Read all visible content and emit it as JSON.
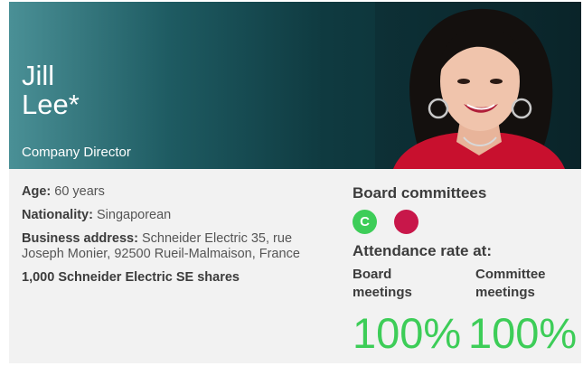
{
  "profile": {
    "name_line1": "Jill",
    "name_line2": "Lee*",
    "role": "Company Director"
  },
  "details": {
    "age_label": "Age:",
    "age_value": "60 years",
    "nationality_label": "Nationality:",
    "nationality_value": "Singaporean",
    "address_label": "Business address:",
    "address_value": "Schneider Electric 35, rue Joseph Monier, 92500 Rueil-Malmaison, France",
    "shares": "1,000 Schneider Electric SE shares"
  },
  "committees": {
    "heading": "Board committees",
    "badges": [
      {
        "letter": "C",
        "color": "#3dcd58"
      },
      {
        "letter": "",
        "color": "#c8174a"
      }
    ]
  },
  "attendance": {
    "heading": "Attendance rate at:",
    "board_label": "Board meetings",
    "committee_label": "Committee meetings",
    "board_rate": "100%",
    "committee_rate": "100%"
  },
  "colors": {
    "accent_green": "#3dcd58",
    "header_dark": "#0b2a2f"
  }
}
